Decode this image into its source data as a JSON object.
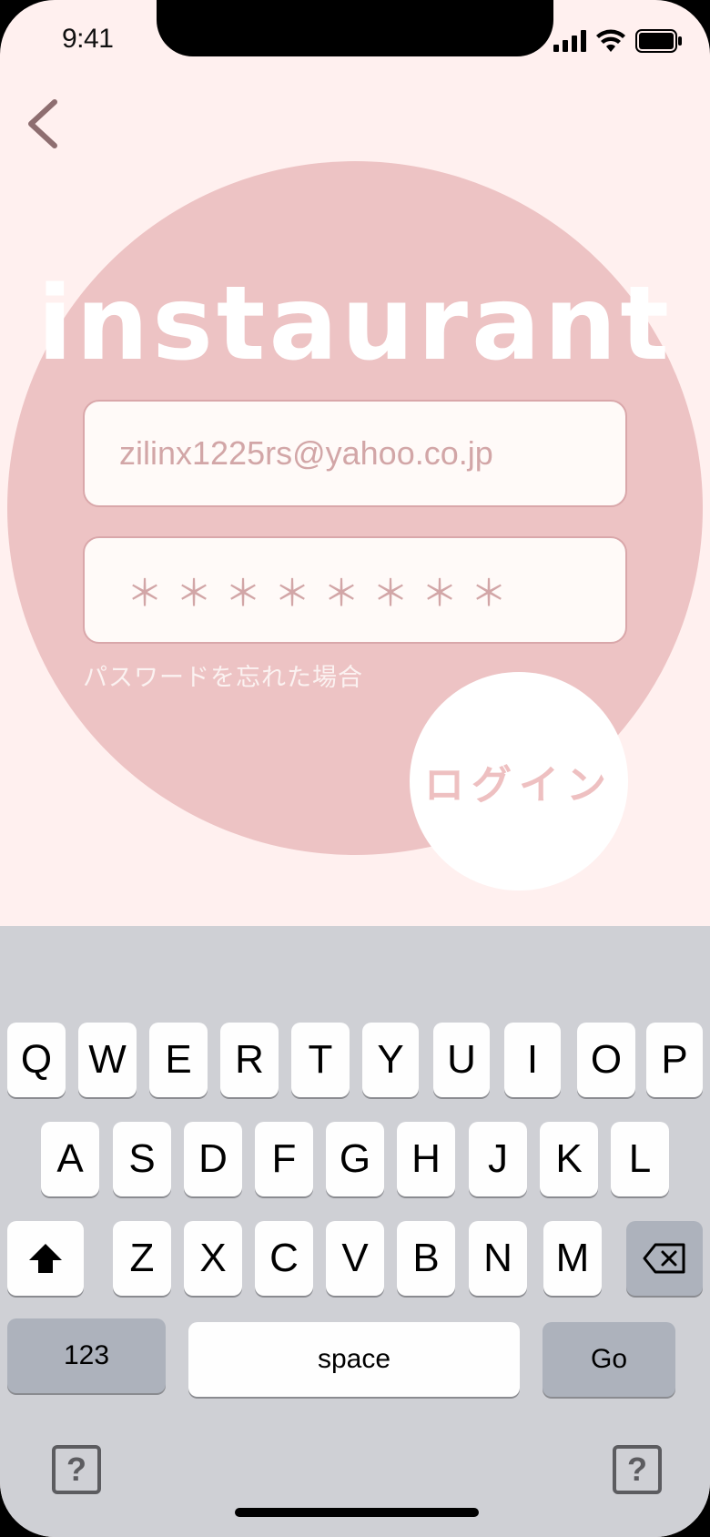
{
  "status_bar": {
    "time": "9:41"
  },
  "app": {
    "logo": "instaurant"
  },
  "form": {
    "email_value": "zilinx1225rs@yahoo.co.jp",
    "password_mask": "＊＊＊＊＊＊＊＊",
    "forgot_password": "パスワードを忘れた場合",
    "login_label": "ログイン"
  },
  "keyboard": {
    "row1": [
      "Q",
      "W",
      "E",
      "R",
      "T",
      "Y",
      "U",
      "I",
      "O",
      "P"
    ],
    "row2": [
      "A",
      "S",
      "D",
      "F",
      "G",
      "H",
      "J",
      "K",
      "L"
    ],
    "row3": [
      "Z",
      "X",
      "C",
      "V",
      "B",
      "N",
      "M"
    ],
    "numbers_label": "123",
    "space_label": "space",
    "go_label": "Go",
    "help_glyph": "?"
  }
}
